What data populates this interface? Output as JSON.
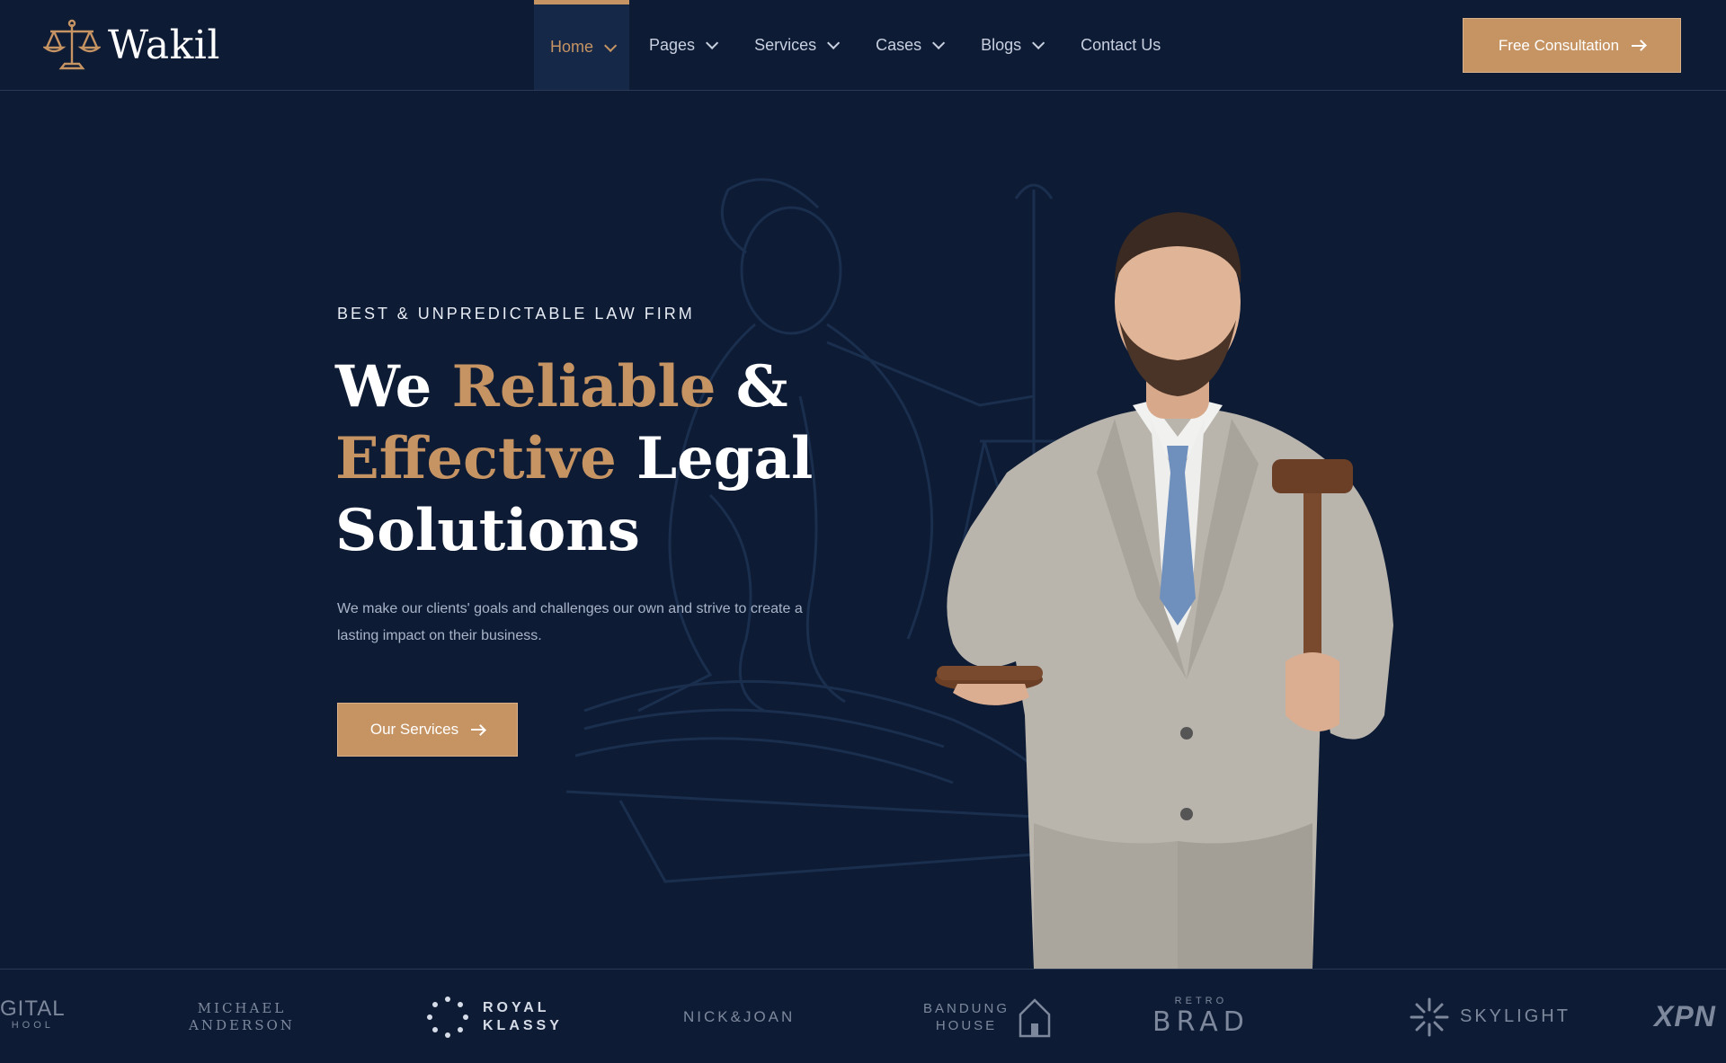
{
  "header": {
    "logo_text": "Wakil",
    "nav": [
      {
        "label": "Home",
        "dropdown": true,
        "active": true
      },
      {
        "label": "Pages",
        "dropdown": true
      },
      {
        "label": "Services",
        "dropdown": true
      },
      {
        "label": "Cases",
        "dropdown": true
      },
      {
        "label": "Blogs",
        "dropdown": true
      },
      {
        "label": "Contact Us",
        "dropdown": false
      }
    ],
    "cta_label": "Free Consultation"
  },
  "hero": {
    "eyebrow": "BEST & UNPREDICTABLE LAW FIRM",
    "headline": {
      "part1": "We ",
      "gold1": "Reliable",
      "part2": " &",
      "gold2": "Effective",
      "part3": " Legal",
      "part4": "Solutions"
    },
    "description": "We make our clients' goals and challenges our own and strive to create a lasting impact on their business.",
    "button_label": "Our Services"
  },
  "brands": [
    {
      "line1": "GITAL",
      "line2": "HOOL"
    },
    {
      "line1": "MICHAEL",
      "line2": "ANDERSON"
    },
    {
      "line1": "ROYAL",
      "line2": "KLASSY"
    },
    {
      "line1": "NICK&JOAN"
    },
    {
      "line1": "BANDUNG",
      "line2": "HOUSE"
    },
    {
      "line1": "RETRO",
      "line2": "BRAD"
    },
    {
      "line1": "SKYLIGHT"
    },
    {
      "line1": "XPN"
    }
  ],
  "colors": {
    "background": "#0d1b35",
    "accent": "#c69463",
    "text_muted": "#a9b4c8"
  }
}
